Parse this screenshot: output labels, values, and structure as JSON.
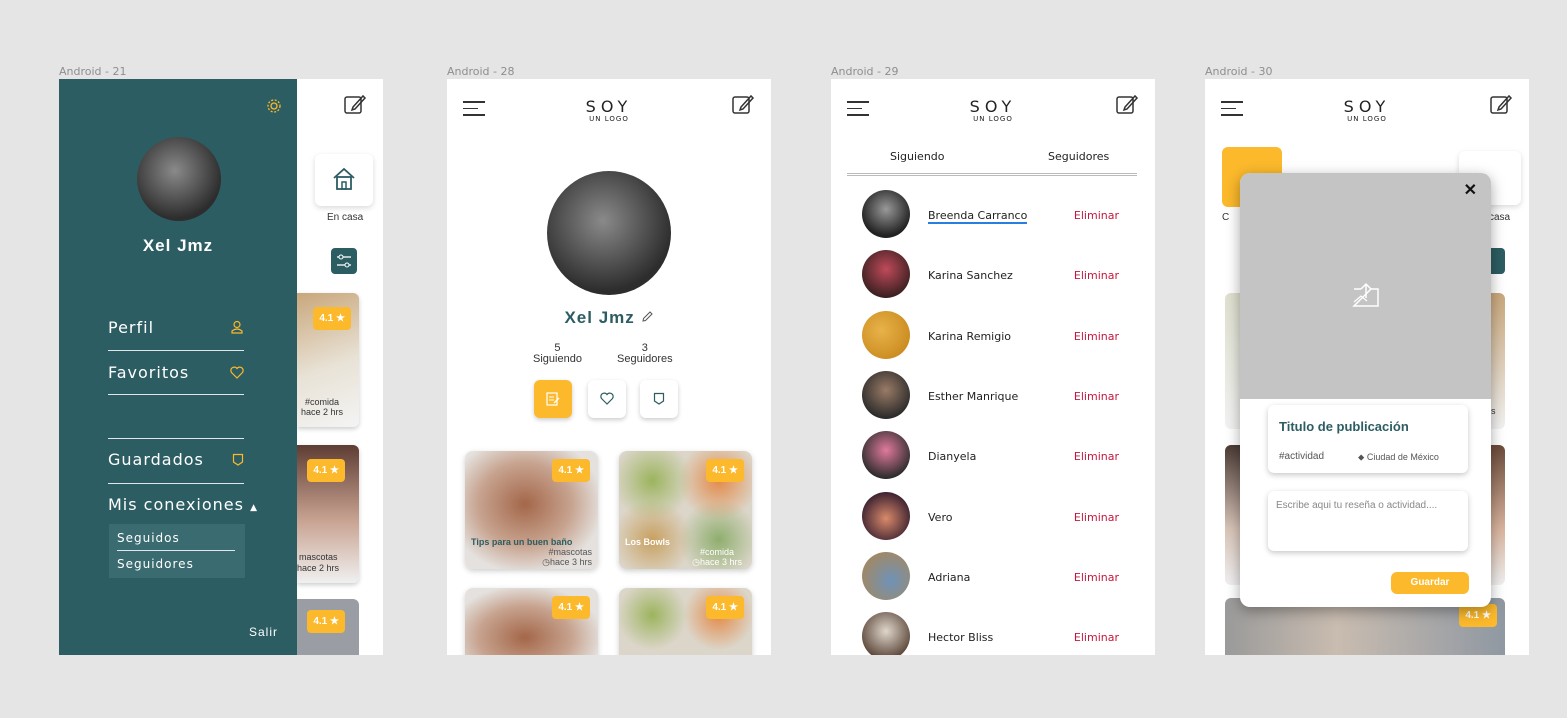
{
  "frames": {
    "a21": "Android - 21",
    "a28": "Android - 28",
    "a29": "Android - 29",
    "a30": "Android - 30"
  },
  "logo": {
    "big": "SOY",
    "small": "UN LOGO"
  },
  "drawer": {
    "user_name": "Xel Jmz",
    "items": {
      "perfil": "Perfil",
      "favoritos": "Favoritos",
      "guardados": "Guardados",
      "conexiones": "Mis conexiones"
    },
    "sub": {
      "seguidos": "Seguidos",
      "seguidores": "Seguidores"
    },
    "salir": "Salir",
    "behind": {
      "en_casa": "En casa",
      "rating": "4.1 ★",
      "tag_comida": "#comida",
      "time1": "hace 2 hrs",
      "tag_mascotas": "mascotas",
      "time2": "hace 2 hrs"
    }
  },
  "profile": {
    "name": "Xel Jmz",
    "siguiendo_count": "5",
    "siguiendo_label": "Siguiendo",
    "seguidores_count": "3",
    "seguidores_label": "Seguidores",
    "cards": [
      {
        "title": "Tips para un buen baño",
        "tag": "#mascotas",
        "time": "hace 3 hrs",
        "rating": "4.1 ★"
      },
      {
        "title": "Los Bowls",
        "tag": "#comida",
        "time": "hace 3 hrs",
        "rating": "4.1 ★"
      },
      {
        "rating": "4.1 ★"
      },
      {
        "rating": "4.1 ★"
      }
    ]
  },
  "connections": {
    "tab_siguiendo": "Siguiendo",
    "tab_seguidores": "Seguidores",
    "delete_label": "Eliminar",
    "rows": [
      {
        "name": "Breenda Carranco"
      },
      {
        "name": "Karina Sanchez"
      },
      {
        "name": "Karina Remigio"
      },
      {
        "name": "Esther Manrique"
      },
      {
        "name": "Dianyela"
      },
      {
        "name": "Vero"
      },
      {
        "name": "Adriana"
      },
      {
        "name": "Hector Bliss"
      }
    ]
  },
  "publish": {
    "title": "Titulo de publicación",
    "tag": "#actividad",
    "location": "Ciudad de México",
    "placeholder": "Escribe aqui tu reseña o actividad....",
    "save": "Guardar",
    "close": "✕",
    "behind_label_left": "C",
    "behind_label_right": "casa",
    "behind_s": "s",
    "behind_rating": "4.1 ★"
  },
  "colors": {
    "teal": "#2c5d62",
    "yellow": "#fbb92b",
    "red": "#c5173c",
    "blue": "#2a7de1"
  }
}
